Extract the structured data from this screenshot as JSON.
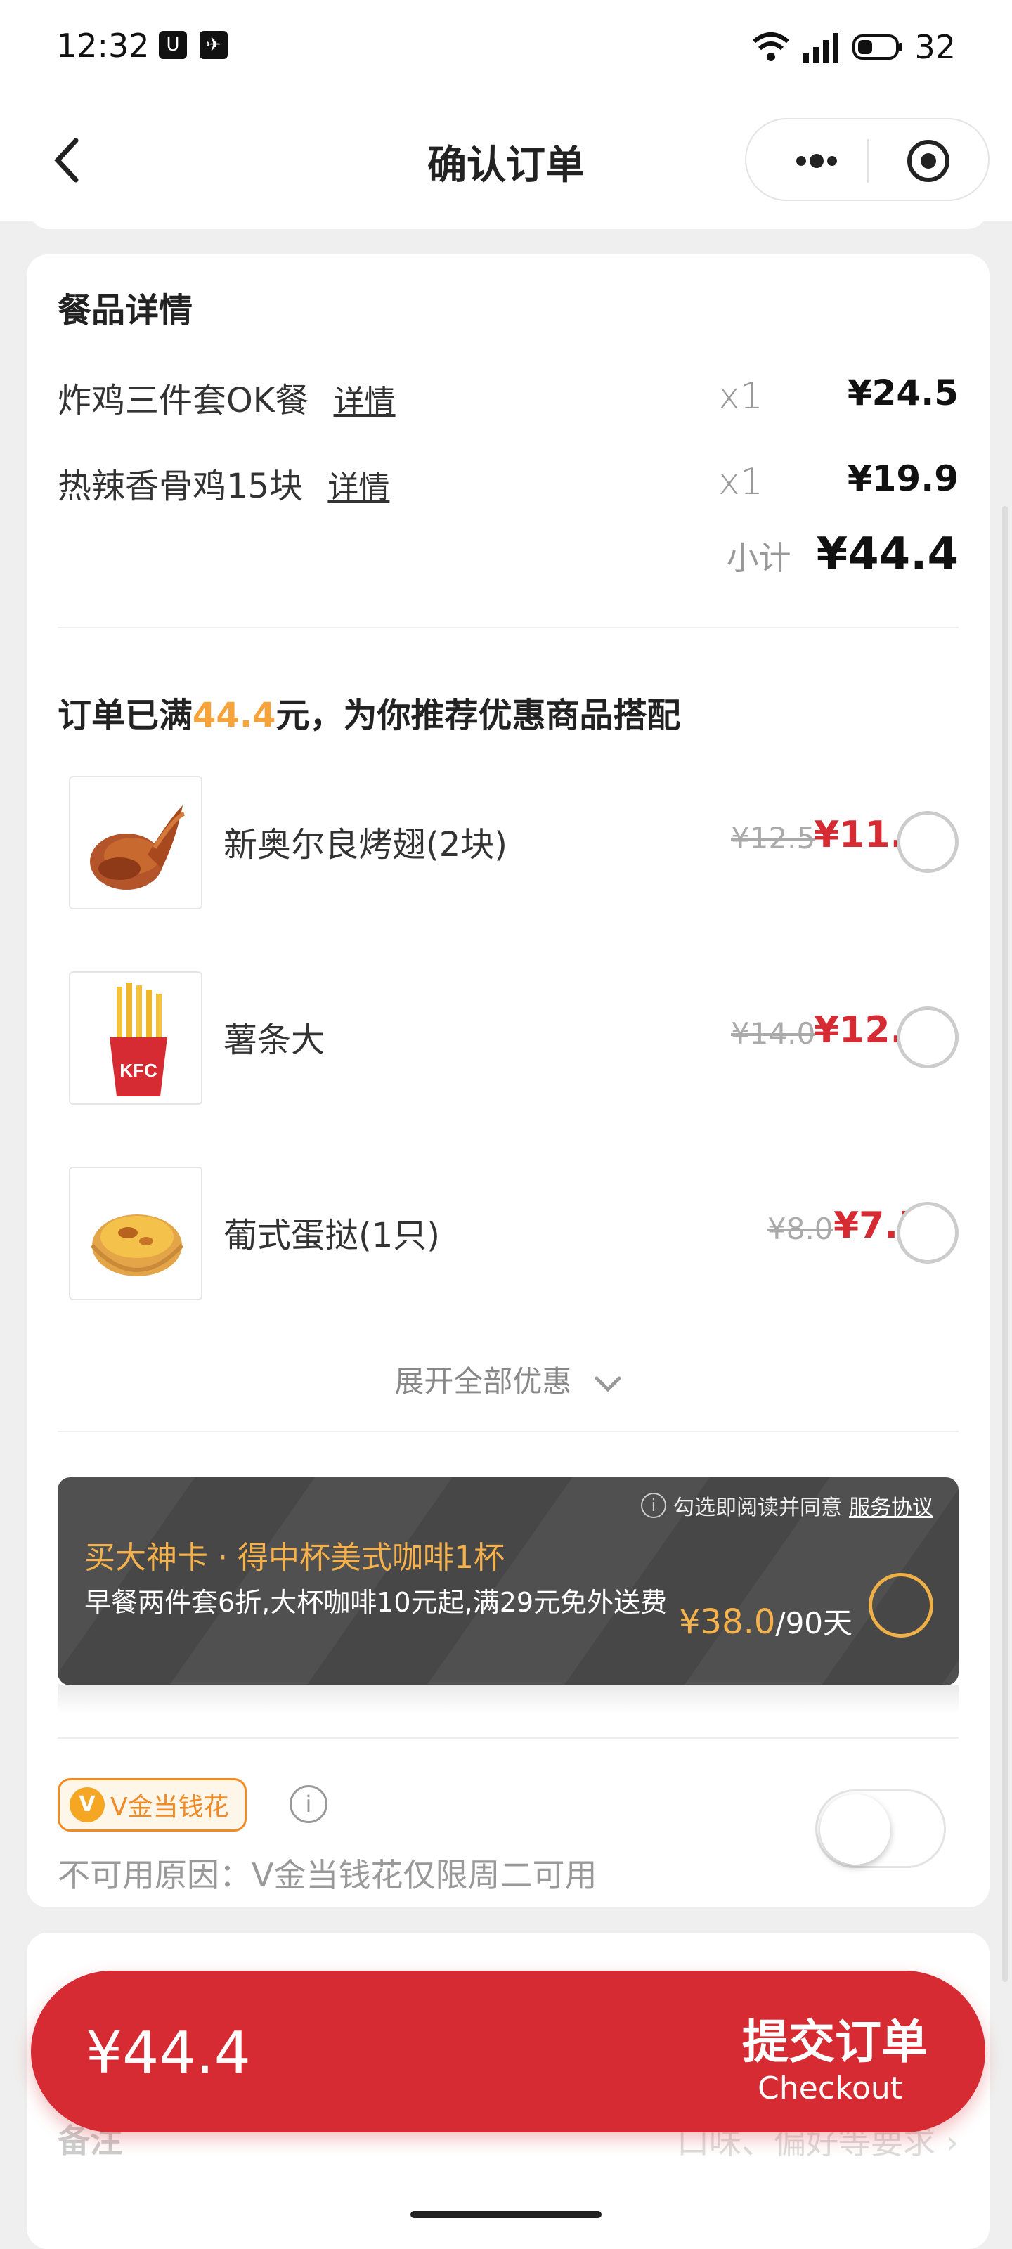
{
  "status_bar": {
    "time": "12:32",
    "battery": "32"
  },
  "nav": {
    "title": "确认订单"
  },
  "meal_details": {
    "title": "餐品详情",
    "items": [
      {
        "name": "炸鸡三件套OK餐",
        "detail": "详情",
        "qty": "x1",
        "price": "¥24.5"
      },
      {
        "name": "热辣香骨鸡15块",
        "detail": "详情",
        "qty": "x1",
        "price": "¥19.9"
      }
    ],
    "subtotal_label": "小计",
    "subtotal_value": "¥44.4"
  },
  "recommend": {
    "title_pre": "订单已满",
    "title_amount": "44.4",
    "title_post": "元，为你推荐优惠商品搭配",
    "items": [
      {
        "name": "新奥尔良烤翅(2块)",
        "old_price": "¥12.5",
        "price": "¥11.5",
        "icon": "chicken-wings"
      },
      {
        "name": "薯条大",
        "old_price": "¥14.0",
        "price": "¥12.5",
        "icon": "french-fries"
      },
      {
        "name": "葡式蛋挞(1只)",
        "old_price": "¥8.0",
        "price": "¥7.5",
        "icon": "egg-tart"
      }
    ],
    "expand_label": "展开全部优惠"
  },
  "god_card": {
    "agree_text": "勾选即阅读并同意",
    "agree_link": "服务协议",
    "title": "买大神卡 · 得中杯美式咖啡1杯",
    "desc": "早餐两件套6折,大杯咖啡10元起,满29元免外送费",
    "price": "¥38.0",
    "unit": "/90天"
  },
  "vgold": {
    "badge": "V金当钱花",
    "coin": "V",
    "reason": "不可用原因：V金当钱花仅限周二可用",
    "enabled": false
  },
  "remark": {
    "label": "备注",
    "hint": "口味、偏好等要求"
  },
  "checkout": {
    "total": "¥44.4",
    "submit": "提交订单",
    "submit_sub": "Checkout"
  }
}
